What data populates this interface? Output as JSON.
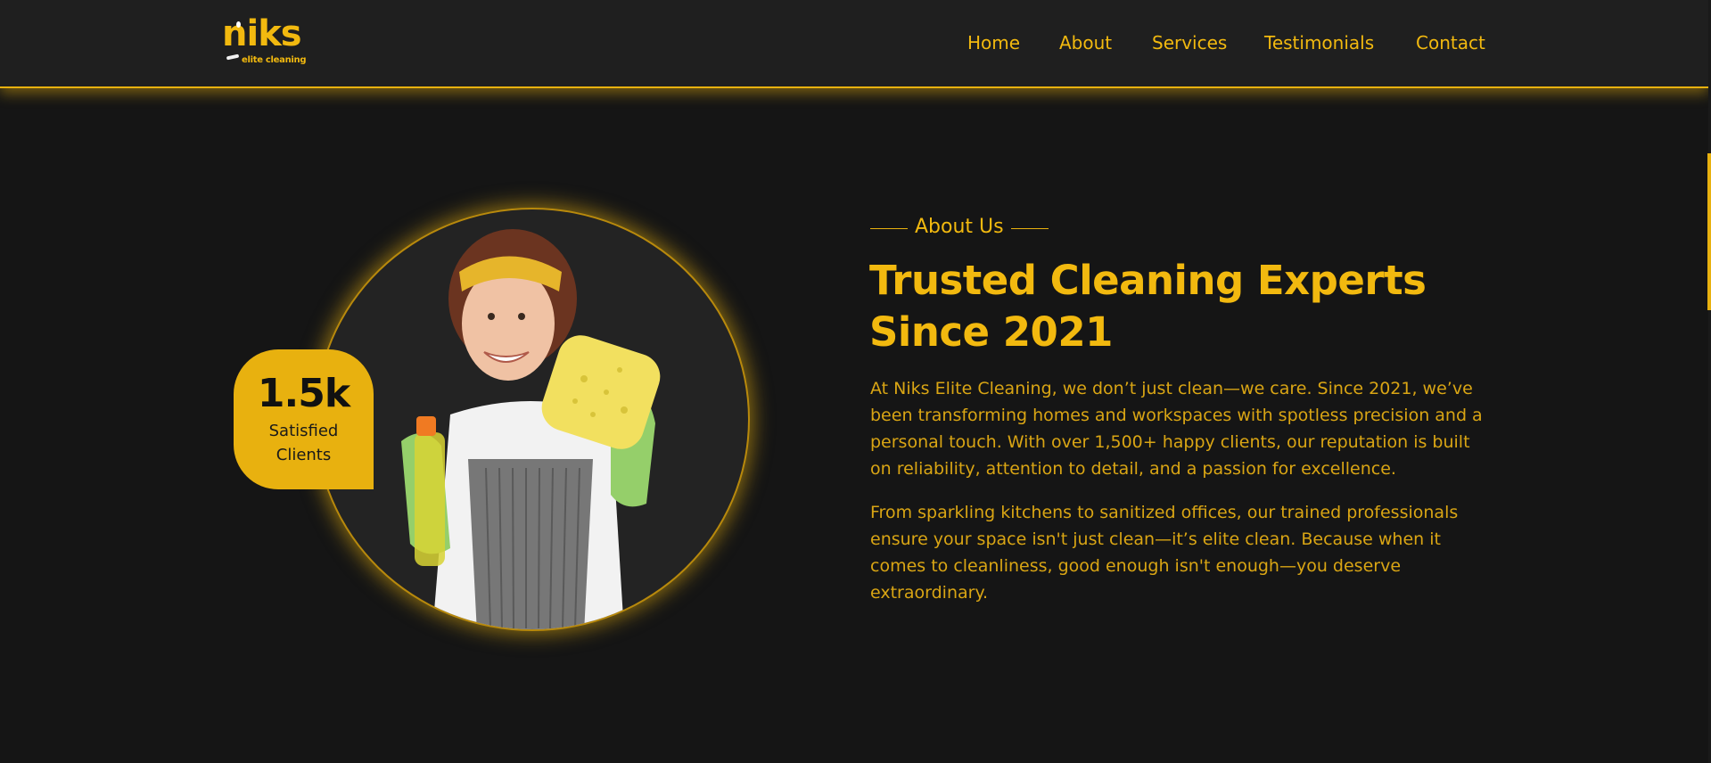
{
  "header": {
    "logo": {
      "word": "niks",
      "sub": "elite cleaning"
    },
    "nav": [
      {
        "label": "Home"
      },
      {
        "label": "About"
      },
      {
        "label": "Services"
      },
      {
        "label": "Testimonials"
      },
      {
        "label": "Contact"
      }
    ]
  },
  "about": {
    "eyebrow": "About Us",
    "heading": "Trusted Cleaning Experts Since 2021",
    "paragraphs": [
      "At Niks Elite Cleaning, we don’t just clean—we care. Since 2021, we’ve been transforming homes and workspaces with spotless precision and a personal touch. With over 1,500+ happy clients, our reputation is built on reliability, attention to detail, and a passion for excellence.",
      "From sparkling kitchens to sanitized offices, our trained professionals ensure your space isn't just clean—it’s elite clean. Because when it comes to cleanliness, good enough isn't enough—you deserve extraordinary."
    ],
    "stat": {
      "value": "1.5k",
      "label": "Satisfied Clients"
    }
  },
  "colors": {
    "accent": "#e8b10f",
    "background": "#151515",
    "header_bg": "#1f1f1f"
  }
}
